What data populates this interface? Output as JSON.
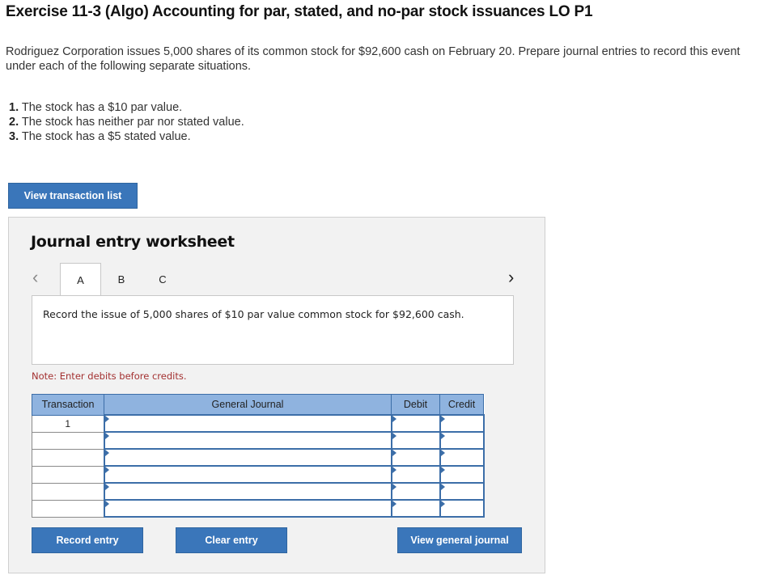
{
  "header": {
    "title": "Exercise 11-3 (Algo) Accounting for par, stated, and no-par stock issuances LO P1",
    "intro": "Rodriguez Corporation issues 5,000 shares of its common stock for $92,600 cash on February 20. Prepare journal entries to record this event under each of the following separate situations."
  },
  "situations": [
    {
      "num": "1.",
      "text": "The stock has a $10 par value."
    },
    {
      "num": "2.",
      "text": "The stock has neither par nor stated value."
    },
    {
      "num": "3.",
      "text": "The stock has a $5 stated value."
    }
  ],
  "buttons": {
    "view_transactions": "View transaction list",
    "record_entry": "Record entry",
    "clear_entry": "Clear entry",
    "view_general_journal": "View general journal"
  },
  "worksheet": {
    "title": "Journal entry worksheet",
    "tabs": [
      "A",
      "B",
      "C"
    ],
    "active_tab": "A",
    "prev_icon": "‹",
    "next_icon": "›",
    "instruction": "Record the issue of 5,000 shares of $10 par value common stock for $92,600 cash.",
    "note": "Note: Enter debits before credits."
  },
  "journal_table": {
    "headers": [
      "Transaction",
      "General Journal",
      "Debit",
      "Credit"
    ],
    "rows": [
      {
        "transaction": "1",
        "account": "",
        "debit": "",
        "credit": ""
      },
      {
        "transaction": "",
        "account": "",
        "debit": "",
        "credit": ""
      },
      {
        "transaction": "",
        "account": "",
        "debit": "",
        "credit": ""
      },
      {
        "transaction": "",
        "account": "",
        "debit": "",
        "credit": ""
      },
      {
        "transaction": "",
        "account": "",
        "debit": "",
        "credit": ""
      },
      {
        "transaction": "",
        "account": "",
        "debit": "",
        "credit": ""
      }
    ]
  },
  "colors": {
    "button_blue": "#3a76ba",
    "table_header": "#8fb3df",
    "input_border": "#3c6ea8",
    "note_red": "#a33030"
  }
}
